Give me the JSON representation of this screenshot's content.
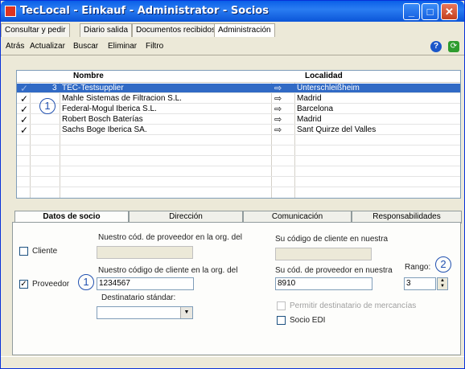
{
  "window": {
    "title": "TecLocal - Einkauf - Administrator - Socios"
  },
  "menu": [
    "Consultar y pedir",
    "Diario salida",
    "Documentos recibidos",
    "Administración"
  ],
  "toolbar": {
    "back": "Atrás",
    "update": "Actualizar",
    "search": "Buscar",
    "delete": "Eliminar",
    "filter": "Filtro"
  },
  "grid": {
    "columns": {
      "name": "Nombre",
      "location": "Localidad"
    },
    "rows": [
      {
        "num": "3",
        "name": "TEC-Testsupplier",
        "location": "Unterschleißheim",
        "selected": true
      },
      {
        "num": "",
        "name": "Mahle Sistemas de Filtracion S.L.",
        "location": "Madrid"
      },
      {
        "num": "",
        "name": "Federal-Mogul Iberica S.L.",
        "location": "Barcelona"
      },
      {
        "num": "",
        "name": "Robert Bosch Baterías",
        "location": "Madrid"
      },
      {
        "num": "",
        "name": "Sachs Boge Iberica SA.",
        "location": "Sant Quirze del Valles"
      }
    ]
  },
  "callouts": {
    "one": "1",
    "two": "2"
  },
  "tabs": {
    "partner": "Datos de socio",
    "address": "Dirección",
    "comm": "Comunicación",
    "resp": "Responsabilidades"
  },
  "form": {
    "client_label": "Cliente",
    "supplier_label": "Proveedor",
    "supplier_code_label": "Nuestro cód. de proveedor en la org. del",
    "client_code_label": "Nuestro código de cliente en la org. del",
    "client_code_value": "1234567",
    "recipient_label": "Destinatario stándar:",
    "their_client_code_label": "Su código de cliente en nuestra",
    "their_supplier_code_label": "Su cód. de proveedor en nuestra",
    "their_supplier_code_value": "8910",
    "range_label": "Rango:",
    "range_value": "3",
    "allow_recipient_label": "Permitir destinatario de mercancías",
    "edi_label": "Socio EDI"
  }
}
